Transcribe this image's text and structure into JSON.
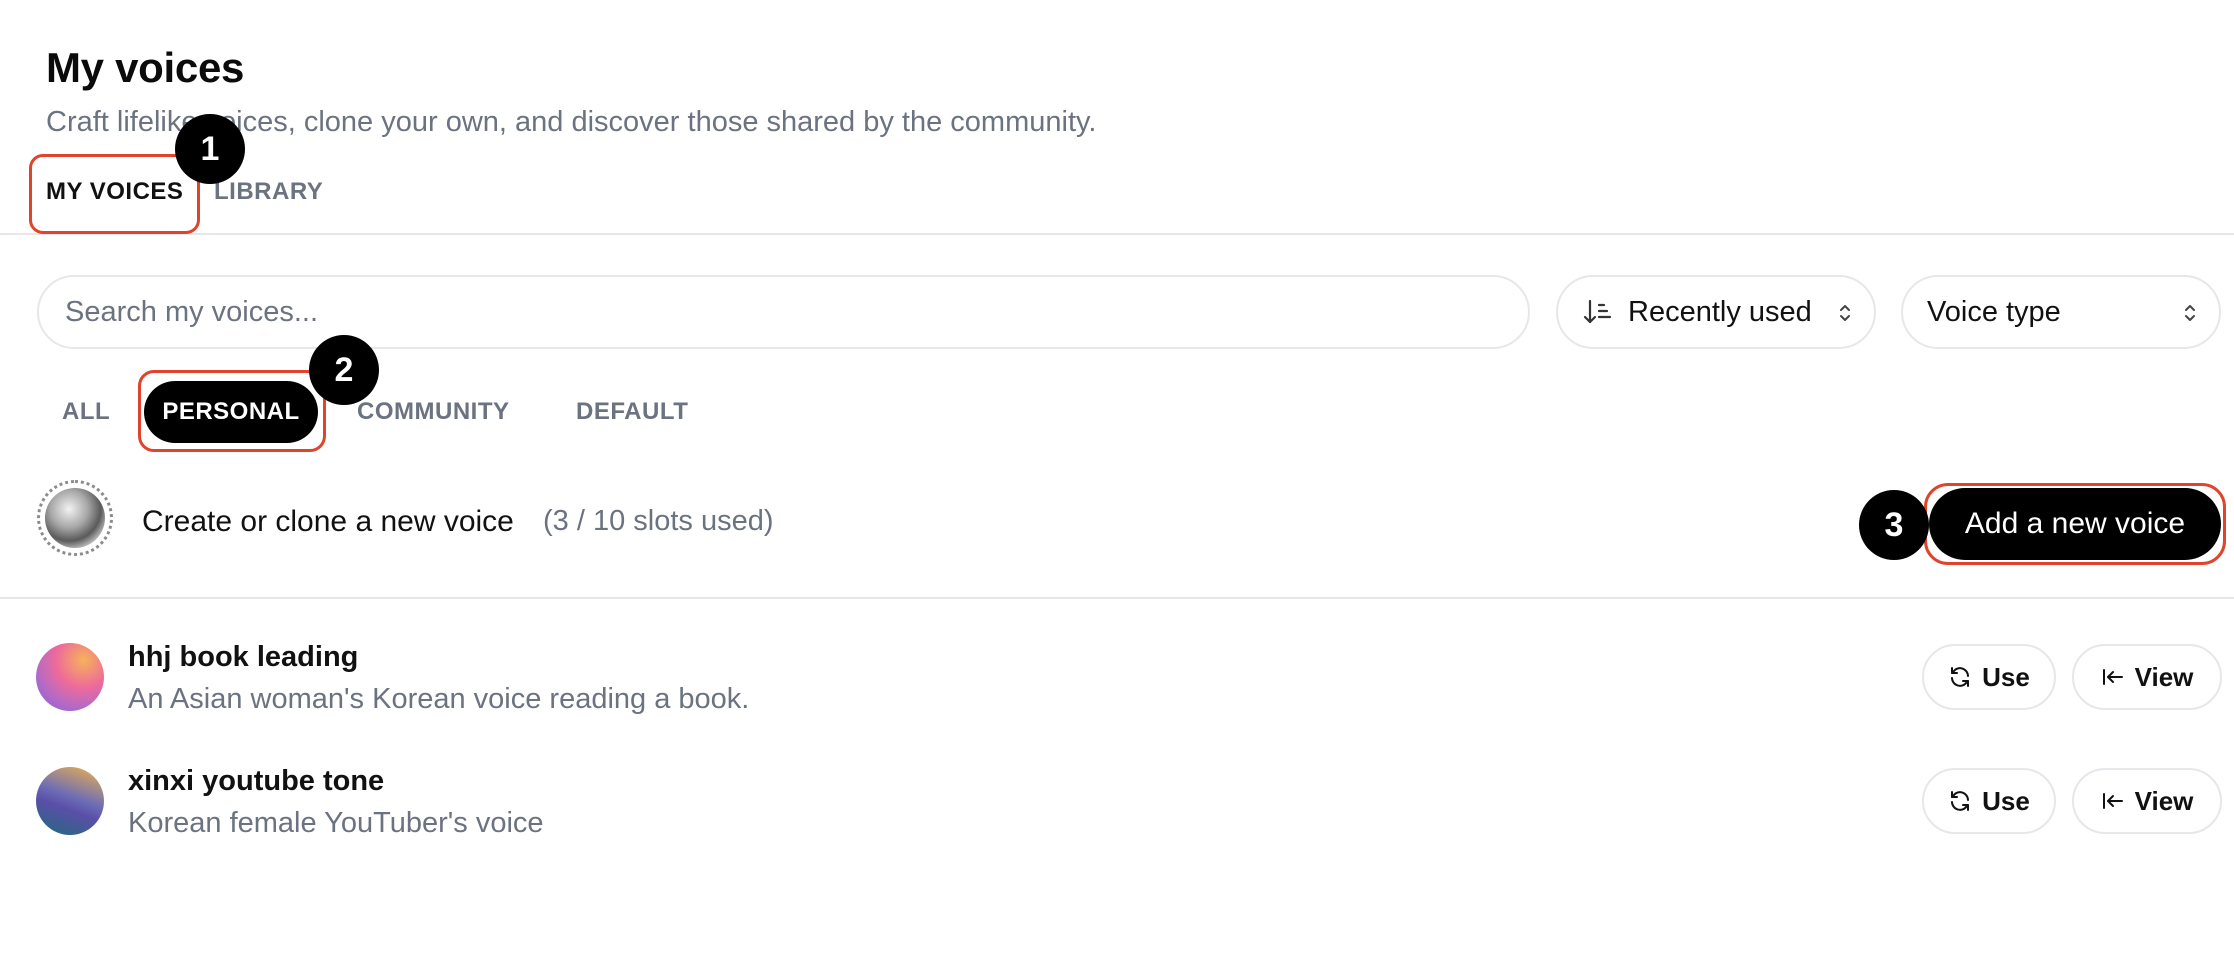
{
  "page": {
    "title": "My voices",
    "subtitle": "Craft lifelike voices, clone your own, and discover those shared by the community."
  },
  "tabs": [
    {
      "label": "MY VOICES",
      "active": true
    },
    {
      "label": "LIBRARY",
      "active": false
    }
  ],
  "search": {
    "placeholder": "Search my voices...",
    "value": ""
  },
  "sort_select": {
    "selected": "Recently used",
    "icon": "sort-descending-icon"
  },
  "type_select": {
    "selected": "Voice type"
  },
  "filters": [
    {
      "label": "ALL",
      "active": false
    },
    {
      "label": "PERSONAL",
      "active": true
    },
    {
      "label": "COMMUNITY",
      "active": false
    },
    {
      "label": "DEFAULT",
      "active": false
    }
  ],
  "create": {
    "label": "Create or clone a new voice",
    "slots": "(3 / 10 slots used)",
    "button_label": "Add a new voice"
  },
  "voices": [
    {
      "name": "hhj book leading",
      "description": "An Asian woman's Korean voice reading a book.",
      "use_label": "Use",
      "view_label": "View"
    },
    {
      "name": "xinxi youtube tone",
      "description": "Korean female YouTuber's voice",
      "use_label": "Use",
      "view_label": "View"
    }
  ],
  "annotations": [
    {
      "number": "1",
      "target": "MY VOICES tab"
    },
    {
      "number": "2",
      "target": "PERSONAL filter"
    },
    {
      "number": "3",
      "target": "Add a new voice button"
    }
  ],
  "colors": {
    "highlight": "#e0442c",
    "badge": "#000000",
    "muted_text": "#6b7280",
    "border": "#e5e7eb"
  }
}
